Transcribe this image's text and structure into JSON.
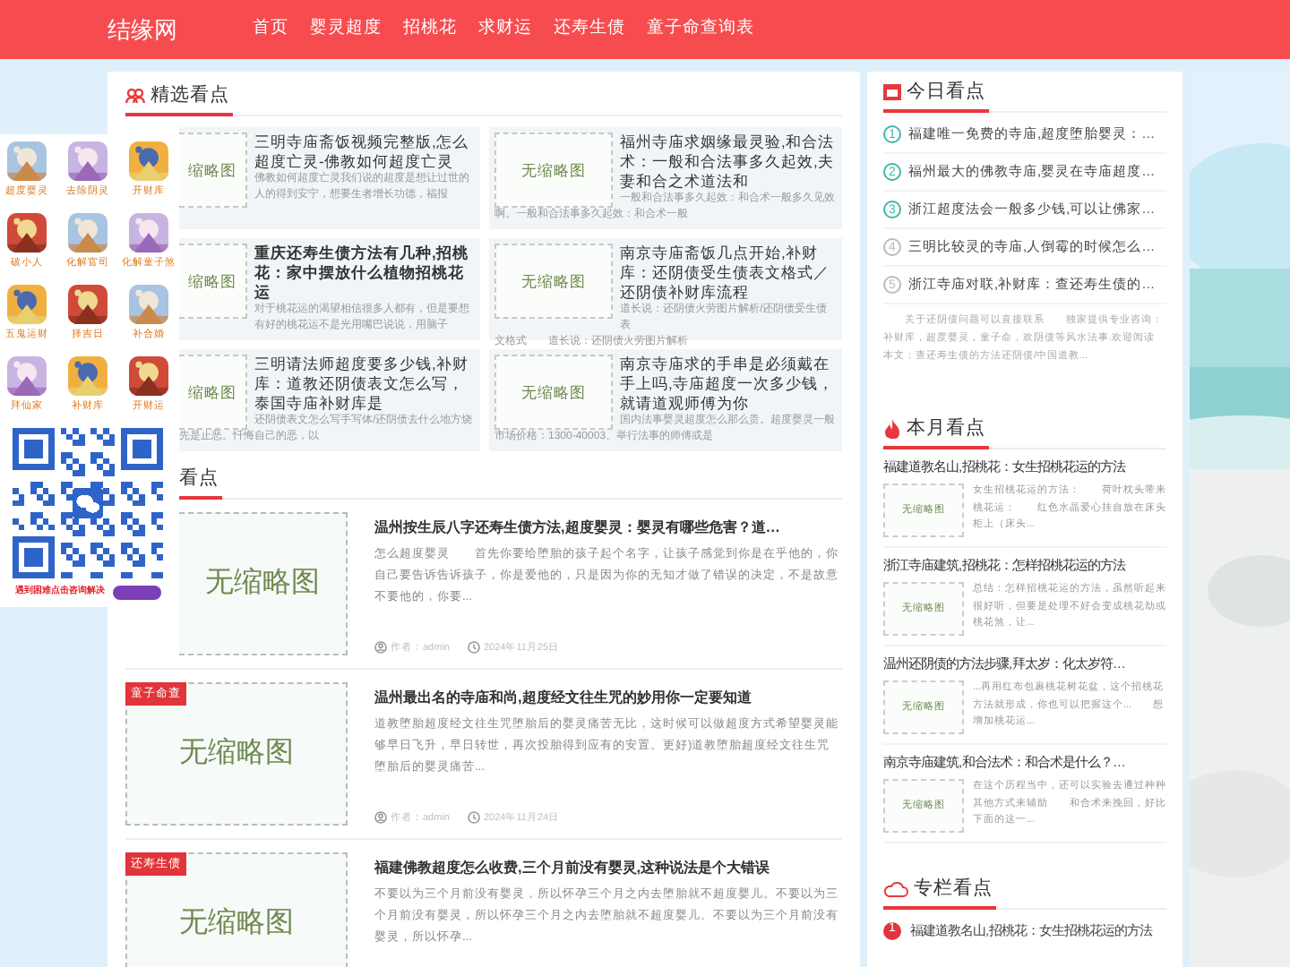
{
  "header": {
    "logo": "结缘网",
    "nav": [
      "首页",
      "婴灵超度",
      "招桃花",
      "求财运",
      "还寿生债",
      "童子命查询表"
    ]
  },
  "featured": {
    "title": "精选看点",
    "cards": [
      {
        "thumb": "缩略图",
        "title": "三明寺庙斋饭视频完整版,怎么超度亡灵-佛教如何超度亡灵",
        "excerpt": "佛教如何超度亡灵我们说的超度是想让过世的人的得到安宁，想要生者增长功德，福报"
      },
      {
        "thumb": "无缩略图",
        "title": "福州寺庙求姻缘最灵验,和合法术：一般和合法事多久起效,夫妻和合之术道法和",
        "excerpt": "一般和合法事多久起效：和合术一般多久见效",
        "tail": "啊。一般和合法事多久起效：和合术一般"
      },
      {
        "thumb": "缩略图",
        "title": "重庆还寿生债方法有几种,招桃花：家中摆放什么植物招桃花运",
        "excerpt": "对于桃花运的渴望相信很多人都有，但是要想有好的桃花运不是光用嘴巴说说，用脑子"
      },
      {
        "thumb": "无缩略图",
        "title": "南京寺庙斋饭几点开始,补财库：还阴债受生债表文格式／还阴债补财库流程",
        "excerpt": "道长说：还阴债火劳图片解析/还阴债受生债表",
        "tail": "文格式　　道长说：还阴债火劳图片解析"
      },
      {
        "thumb": "缩略图",
        "title": "三明请法师超度要多少钱,补财库：道教还阴债表文怎么写，泰国寺庙补财库是",
        "excerpt": "还阴债表文怎么写手写体/还阴债去什么地方烧",
        "tail": "先是止恶。忏悔自己的恶，以"
      },
      {
        "thumb": "无缩略图",
        "title": "南京寺庙求的手串是必须戴在手上吗,寺庙超度一次多少钱，就请道观师傅为你",
        "excerpt": "国内法事婴灵超度怎么那么贵。超度婴灵一般",
        "tail": "市场价格：1300-40003、举行法事的师傅或是"
      }
    ]
  },
  "articles": {
    "title": "看点",
    "items": [
      {
        "thumb": "无缩略图",
        "title": "温州按生辰八字还寿生债方法,超度婴灵：婴灵有哪些危害？道…",
        "excerpt": "怎么超度婴灵　　首先你要给堕胎的孩子起个名字，让孩子感觉到你是在乎他的，你自己要告诉告诉孩子，你是爱他的，只是因为你的无知才做了错误的决定，不是故意不要他的，你要...",
        "author": "作者：admin",
        "date": "2024年11月25日"
      },
      {
        "tag": "童子命查",
        "thumb": "无缩略图",
        "title": "温州最出名的寺庙和尚,超度经文往生咒的妙用你一定要知道",
        "excerpt": "道教堕胎超度经文往生咒堕胎后的婴灵痛苦无比，这时候可以做超度方式希望婴灵能够早日飞升，早日转世，再次投胎得到应有的安置。更好)道教堕胎超度经文往生咒堕胎后的婴灵痛苦...",
        "author": "作者：admin",
        "date": "2024年11月24日"
      },
      {
        "tag": "还寿生债",
        "thumb": "无缩略图",
        "title": "福建佛教超度怎么收费,三个月前没有婴灵,这种说法是个大错误",
        "excerpt": "不要以为三个月前没有婴灵，所以怀孕三个月之内去堕胎就不超度婴儿。不要以为三个月前没有婴灵，所以怀孕三个月之内去堕胎就不超度婴儿。不要以为三个月前没有婴灵，所以怀孕..."
      }
    ]
  },
  "today": {
    "title": "今日看点",
    "items": [
      {
        "num": "1",
        "text": "福建唯一免费的寺庙,超度堕胎婴灵：…",
        "color": "#3db8a9"
      },
      {
        "num": "2",
        "text": "福州最大的佛教寺庙,婴灵在寺庙超度…",
        "color": "#3db8a9"
      },
      {
        "num": "3",
        "text": "浙江超度法会一般多少钱,可以让佛家…",
        "color": "#3db8a9"
      },
      {
        "num": "4",
        "text": "三明比较灵的寺庙,人倒霉的时候怎么…",
        "color": "#bbbbbb"
      },
      {
        "num": "5",
        "text": "浙江寺庙对联,补财库：查还寿生债的…",
        "color": "#bbbbbb"
      }
    ],
    "note": "关于还阴债问题可以直接联系　　独家提供专业咨询：补财库，超度婴灵，童子命，欢阴债等风水法事.欢迎阅读本文：查还寿生债的方法还阴债/中国道教..."
  },
  "month": {
    "title": "本月看点",
    "items": [
      {
        "title": "福建道教名山,招桃花：女生招桃花运的方法",
        "thumb": "无缩略图",
        "excerpt": "女生招桃花运的方法：　　荷叶枕头带来桃花运：　　红色水晶爱心挂自放在床头柜上（床头..."
      },
      {
        "title": "浙江寺庙建筑,招桃花：怎样招桃花运的方法",
        "thumb": "无缩略图",
        "excerpt": "总结：怎样招桃花运的方法，虽然听起来很好听，但要是处理不好会变成桃花劫或桃花煞，让..."
      },
      {
        "title": "温州还阴债的方法步骤,拜太岁：化太岁符…",
        "thumb": "无缩略图",
        "excerpt": "...再用红布包裹桃花树花盆，这个招桃花方法就形成，你也可以把握这个...　　想增加桃花运..."
      },
      {
        "title": "南京寺庙建筑,和合法术：和合术是什么？…",
        "thumb": "无缩略图",
        "excerpt": "在这个历程当中，还可以实验去通过种种其他方式来辅助　　和合术来挽回，好比下面的这一..."
      }
    ]
  },
  "column": {
    "title": "专栏看点",
    "items": [
      {
        "num": "1",
        "text": "福建道教名山,招桃花：女生招桃花运的方法"
      }
    ]
  },
  "ad": {
    "apps": [
      "超度婴灵",
      "去除阴灵",
      "开财库",
      "破小人",
      "化解官司",
      "化解童子煞",
      "五鬼运财",
      "择吉日",
      "补合婚",
      "拜仙家",
      "补财库",
      "开财运"
    ],
    "caption": "遇到困难点击咨询解决"
  }
}
